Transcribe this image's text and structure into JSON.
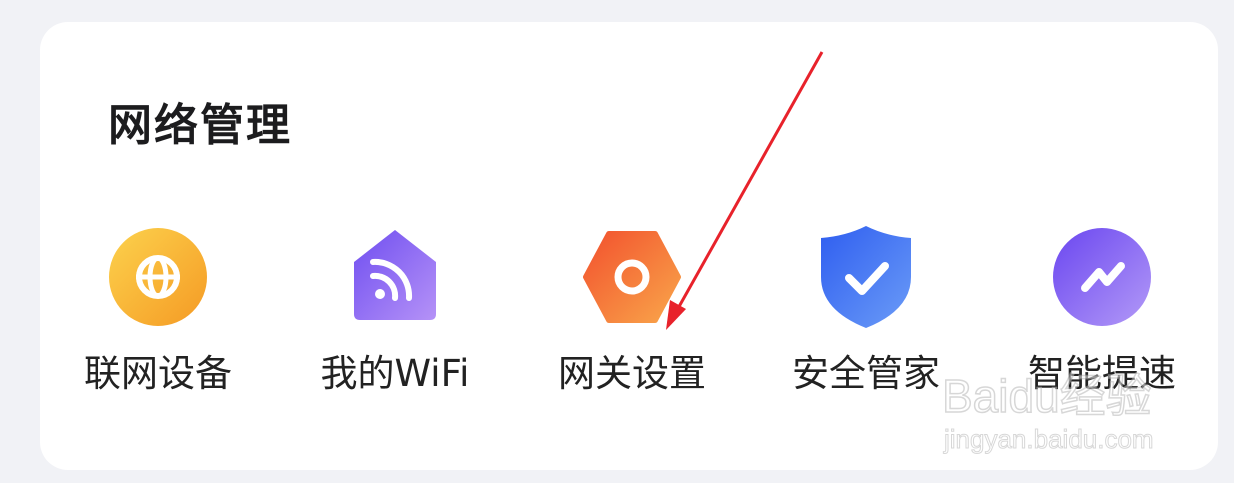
{
  "section": {
    "title": "网络管理"
  },
  "items": [
    {
      "label": "联网设备",
      "icon": "globe-icon"
    },
    {
      "label": "我的WiFi",
      "icon": "wifi-home-icon"
    },
    {
      "label": "网关设置",
      "icon": "gateway-hexagon-icon"
    },
    {
      "label": "安全管家",
      "icon": "shield-check-icon"
    },
    {
      "label": "智能提速",
      "icon": "speed-boost-icon"
    }
  ],
  "watermark": {
    "brand": "Baidu经验",
    "url": "jingyan.baidu.com"
  },
  "colors": {
    "background": "#f1f2f6",
    "card": "#ffffff",
    "arrow": "#e8222b",
    "globe": "#f8b534",
    "wifi": "#7b5cf0",
    "gateway": "#f47b35",
    "shield": "#3c6ef3",
    "boost": "#7f5ff5"
  }
}
